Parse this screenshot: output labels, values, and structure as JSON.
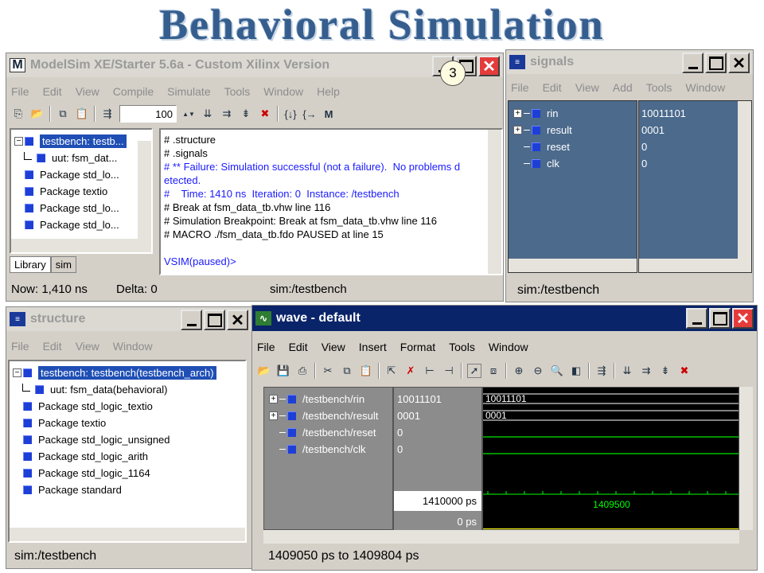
{
  "slide": {
    "title": "Behavioral Simulation",
    "badge": "3"
  },
  "modelsim": {
    "title": "ModelSim XE/Starter 5.6a - Custom Xilinx Version",
    "menu": [
      "File",
      "Edit",
      "View",
      "Compile",
      "Simulate",
      "Tools",
      "Window",
      "Help"
    ],
    "zoom_value": "100",
    "tree": [
      {
        "label": "testbench: testb...",
        "indent": 0,
        "expand": "−",
        "selected": true
      },
      {
        "label": "uut: fsm_dat...",
        "indent": 1
      },
      {
        "label": "Package std_lo...",
        "indent": 0
      },
      {
        "label": "Package textio",
        "indent": 0
      },
      {
        "label": "Package std_lo...",
        "indent": 0
      },
      {
        "label": "Package std_lo...",
        "indent": 0
      }
    ],
    "tabs": [
      "Library",
      "sim"
    ],
    "transcript": [
      {
        "t": "# .structure",
        "c": "#000"
      },
      {
        "t": "# .signals",
        "c": "#000"
      },
      {
        "t": "# ** Failure: Simulation successful (not a failure).  No problems d",
        "c": "#1a1aff"
      },
      {
        "t": "etected.",
        "c": "#1a1aff"
      },
      {
        "t": "#    Time: 1410 ns  Iteration: 0  Instance: /testbench",
        "c": "#1a1aff"
      },
      {
        "t": "# Break at fsm_data_tb.vhw line 116",
        "c": "#000"
      },
      {
        "t": "# Simulation Breakpoint: Break at fsm_data_tb.vhw line 116",
        "c": "#000"
      },
      {
        "t": "# MACRO ./fsm_data_tb.fdo PAUSED at line 15",
        "c": "#000"
      },
      {
        "t": "",
        "c": "#000"
      },
      {
        "t": "VSIM(paused)>",
        "c": "#1a1aff"
      }
    ],
    "status_now": "Now: 1,410 ns",
    "status_delta": "Delta: 0",
    "status_path": "sim:/testbench"
  },
  "signals": {
    "title": "signals",
    "menu": [
      "File",
      "Edit",
      "View",
      "Add",
      "Tools",
      "Window"
    ],
    "rows": [
      {
        "name": "rin",
        "value": "10011101",
        "expand": true
      },
      {
        "name": "result",
        "value": "0001",
        "expand": true
      },
      {
        "name": "reset",
        "value": "0",
        "expand": false
      },
      {
        "name": "clk",
        "value": "0",
        "expand": false
      }
    ],
    "status": "sim:/testbench"
  },
  "structure": {
    "title": "structure",
    "menu": [
      "File",
      "Edit",
      "View",
      "Window"
    ],
    "tree": [
      {
        "label": "testbench: testbench(testbench_arch)",
        "indent": 0,
        "selected": true,
        "expand": "−"
      },
      {
        "label": "uut: fsm_data(behavioral)",
        "indent": 1
      },
      {
        "label": "Package std_logic_textio",
        "indent": 0
      },
      {
        "label": "Package textio",
        "indent": 0
      },
      {
        "label": "Package std_logic_unsigned",
        "indent": 0
      },
      {
        "label": "Package std_logic_arith",
        "indent": 0
      },
      {
        "label": "Package std_logic_1164",
        "indent": 0
      },
      {
        "label": "Package standard",
        "indent": 0
      }
    ],
    "status": "sim:/testbench"
  },
  "wave": {
    "title": "wave - default",
    "menu": [
      "File",
      "Edit",
      "View",
      "Insert",
      "Format",
      "Tools",
      "Window"
    ],
    "signals": [
      {
        "name": "/testbench/rin",
        "value": "10011101",
        "expand": true,
        "kind": "bus"
      },
      {
        "name": "/testbench/result",
        "value": "0001",
        "expand": true,
        "kind": "bus"
      },
      {
        "name": "/testbench/reset",
        "value": "0",
        "expand": false,
        "kind": "low"
      },
      {
        "name": "/testbench/clk",
        "value": "0",
        "expand": false,
        "kind": "low"
      }
    ],
    "now_time": "1410000 ps",
    "cursor_time": "0 ps",
    "cursor_label": "1409500",
    "range": "1409050 ps to 1409804 ps",
    "colors": {
      "bus": "#ffffff",
      "low": "#00c000",
      "grid": "#00ff00",
      "cursor": "#ffff00"
    }
  }
}
